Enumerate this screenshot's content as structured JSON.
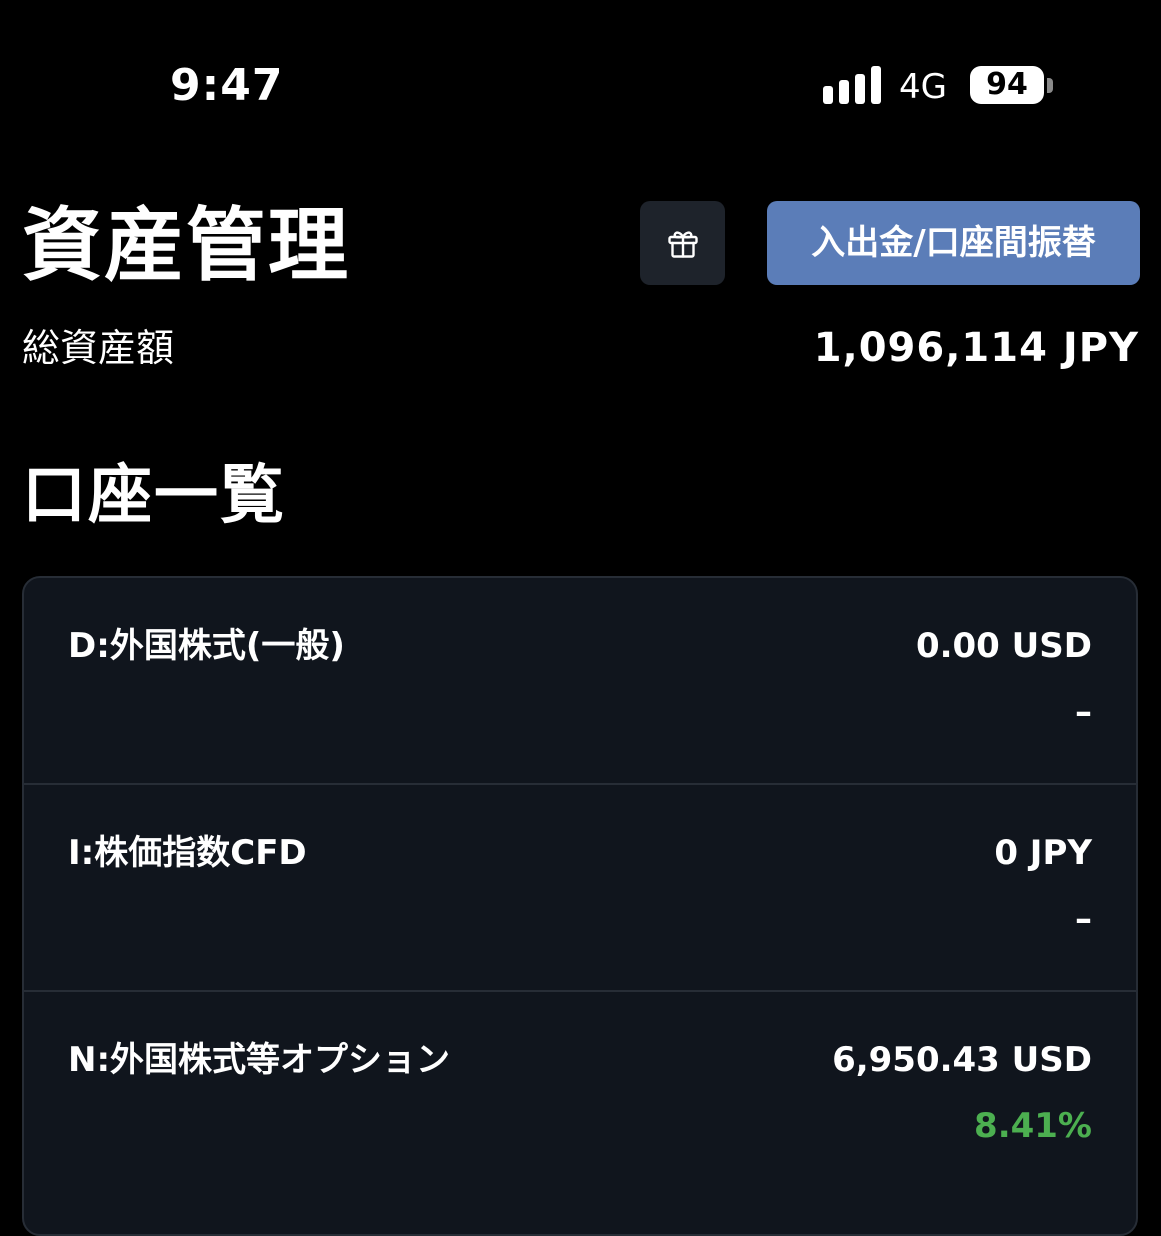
{
  "status_bar": {
    "time": "9:47",
    "network": "4G",
    "battery": "94",
    "signal_icon": "signal-bars-icon"
  },
  "header": {
    "title": "資産管理",
    "gift_icon": "gift-icon",
    "transfer_button_label": "入出金/口座間振替"
  },
  "summary": {
    "total_label": "総資産額",
    "total_value": "1,096,114 JPY"
  },
  "accounts_section": {
    "title": "口座一覧",
    "accounts": [
      {
        "name": "D:外国株式(一般)",
        "value": "0.00 USD",
        "change": "–"
      },
      {
        "name": "I:株価指数CFD",
        "value": "0 JPY",
        "change": "–"
      },
      {
        "name": "N:外国株式等オプション",
        "value": "6,950.43 USD",
        "change": "8.41%"
      }
    ]
  },
  "colors": {
    "background": "#000000",
    "accent_button": "#5b7db8",
    "card_background": "#10151d",
    "positive_change": "#4caf50"
  }
}
